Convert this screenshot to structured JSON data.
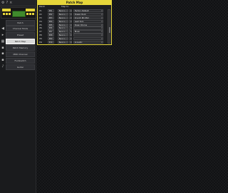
{
  "topbar": {
    "icons": [
      "gear-icon",
      "help-icon",
      "close-icon"
    ],
    "glyphs": [
      "⚙",
      "?",
      "×"
    ]
  },
  "device": {
    "left_label": "",
    "screen_text": "",
    "right_label": ""
  },
  "sidebar": {
    "items": [
      {
        "label": "Patch",
        "icon": "",
        "active": false
      },
      {
        "label": "Channel Mode",
        "icon": "◀",
        "active": false
      },
      {
        "label": "Preset",
        "icon": "▸",
        "active": false
      },
      {
        "label": "Patch Map",
        "icon": "▦",
        "active": true
      },
      {
        "label": "Patch Memory",
        "icon": "▪",
        "active": false
      },
      {
        "label": "MIDI Channel",
        "icon": "▪",
        "active": false
      },
      {
        "label": "Footswitch",
        "icon": "▪",
        "active": false
      },
      {
        "label": "Guitar",
        "icon": "♪",
        "active": false
      }
    ]
  },
  "dialog": {
    "title": "Patch Map",
    "header_patch": "Patch",
    "header_map": "Map to",
    "rows": [
      {
        "pre": "P1",
        "num": "P01",
        "type": "Bank A",
        "ch": "1",
        "name": "Factory Default"
      },
      {
        "pre": "P2",
        "num": "P02",
        "type": "Bank A",
        "ch": "1",
        "name": "Classic Rock"
      },
      {
        "pre": "P3",
        "num": "P03",
        "type": "Bank A",
        "ch": "1",
        "name": "Crunch Rhythm"
      },
      {
        "pre": "P4",
        "num": "P04",
        "type": "Bank A",
        "ch": "1",
        "name": "Lead Solo"
      },
      {
        "pre": "P5",
        "num": "P05",
        "type": "Bank A",
        "ch": "1",
        "name": "Clean Chorus"
      },
      {
        "pre": "P6",
        "num": "P06",
        "type": "Bank A",
        "ch": "1",
        "name": ""
      },
      {
        "pre": "P7",
        "num": "P07",
        "type": "Bank A",
        "ch": "1",
        "name": "Blues"
      },
      {
        "pre": "P8",
        "num": "P08",
        "type": "Bank A",
        "ch": "1",
        "name": ""
      },
      {
        "pre": "P9",
        "num": "P09",
        "type": "Bank A",
        "ch": "1",
        "name": ""
      },
      {
        "pre": "P10",
        "num": "P10",
        "type": "Bank A",
        "ch": "1",
        "name": "Acoustic"
      }
    ]
  },
  "colors": {
    "accent": "#e6d63a",
    "lcd": "#3f8a2c",
    "background": "#111214",
    "panel": "#1d1e20"
  }
}
